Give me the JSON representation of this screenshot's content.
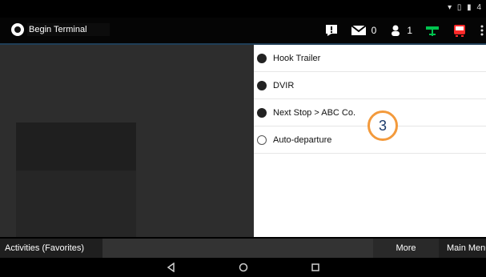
{
  "app": {
    "title": "Begin Terminal"
  },
  "actionbar": {
    "messages_count": "0",
    "users_count": "1",
    "colors": {
      "bus": "#ff2a2a",
      "alert": "#ffffff",
      "team": "#00c44f"
    }
  },
  "menu": {
    "items": [
      {
        "label": "Hook Trailer",
        "filled": true
      },
      {
        "label": "DVIR",
        "filled": true
      },
      {
        "label": "Next Stop  >  ABC Co.",
        "filled": true
      },
      {
        "label": "Auto-departure",
        "filled": false
      }
    ]
  },
  "annotation": {
    "marker": "3",
    "accent": "#f39a3c"
  },
  "tabs": {
    "favorites": "Activities (Favorites)",
    "more": "More",
    "main_menu": "Main Menu"
  },
  "navbar": {
    "back": "back-icon",
    "home": "home-icon",
    "recents": "recents-icon"
  }
}
